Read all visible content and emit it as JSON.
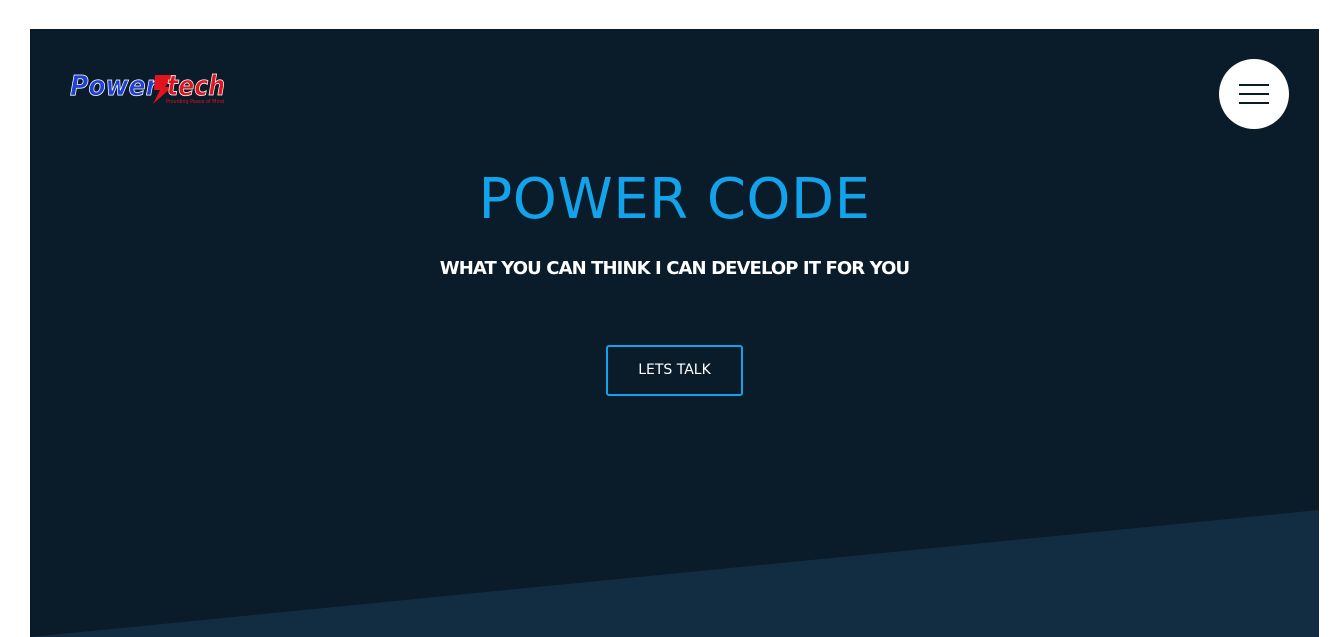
{
  "brand": {
    "logo_text": "Powertech",
    "logo_tagline": "Providing Peace of Mind"
  },
  "nav": {
    "menu_icon": "hamburger-menu-icon"
  },
  "hero": {
    "title": "POWER CODE",
    "subtitle": "WHAT YOU CAN THINK I CAN DEVELOP IT FOR YOU",
    "cta_label": "LETS TALK"
  },
  "colors": {
    "background": "#0a1b29",
    "accent": "#12a3ea",
    "slant": "#122d42",
    "text": "#ffffff",
    "logo_blue": "#1f3fd6",
    "logo_red": "#e0141e"
  }
}
